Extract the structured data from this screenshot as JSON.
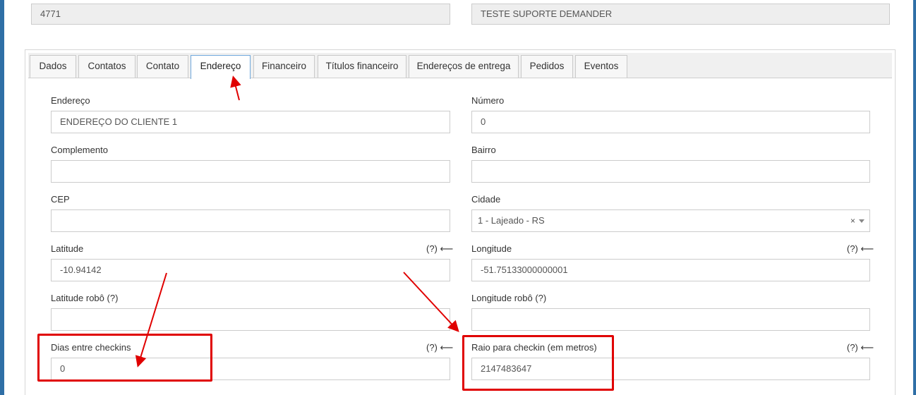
{
  "top_fields": {
    "code_value": "4771",
    "name_value": "TESTE SUPORTE DEMANDER"
  },
  "tabs": [
    {
      "label": "Dados",
      "active": false
    },
    {
      "label": "Contatos",
      "active": false
    },
    {
      "label": "Contato",
      "active": false
    },
    {
      "label": "Endereço",
      "active": true
    },
    {
      "label": "Financeiro",
      "active": false
    },
    {
      "label": "Títulos financeiro",
      "active": false
    },
    {
      "label": "Endereços de entrega",
      "active": false
    },
    {
      "label": "Pedidos",
      "active": false
    },
    {
      "label": "Eventos",
      "active": false
    }
  ],
  "form": {
    "endereco": {
      "label": "Endereço",
      "value": "ENDEREÇO DO CLIENTE 1"
    },
    "numero": {
      "label": "Número",
      "value": "0"
    },
    "complemento": {
      "label": "Complemento",
      "value": ""
    },
    "bairro": {
      "label": "Bairro",
      "value": ""
    },
    "cep": {
      "label": "CEP",
      "value": ""
    },
    "cidade": {
      "label": "Cidade",
      "value": "1 - Lajeado - RS",
      "clear": "×"
    },
    "latitude": {
      "label": "Latitude",
      "help": "(?) ⟵",
      "value": "-10.94142"
    },
    "longitude": {
      "label": "Longitude",
      "help": "(?) ⟵",
      "value": "-51.75133000000001"
    },
    "latitude_robo": {
      "label": "Latitude robô (?)",
      "value": ""
    },
    "longitude_robo": {
      "label": "Longitude robô (?)",
      "value": ""
    },
    "dias_checkins": {
      "label": "Dias entre checkins",
      "help": "(?) ⟵",
      "value": "0"
    },
    "raio_checkin": {
      "label": "Raio para checkin (em metros)",
      "help": "(?) ⟵",
      "value": "2147483647"
    }
  },
  "colors": {
    "annotation": "#e00000",
    "active_tab_border": "#6fa8dc",
    "side_bar": "#2f6fa6"
  }
}
